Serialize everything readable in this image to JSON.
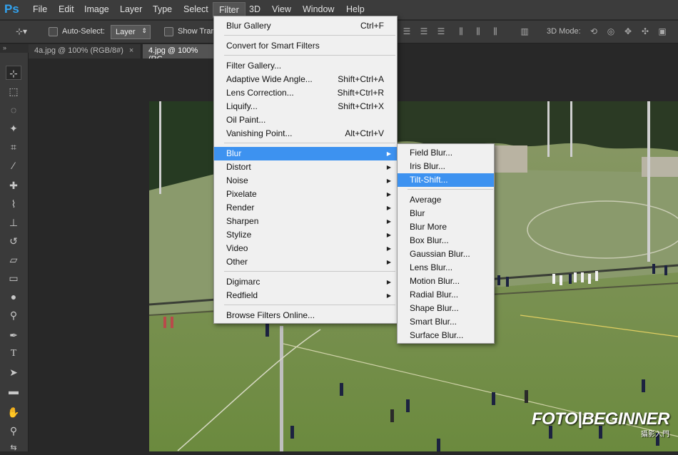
{
  "app": {
    "logo": "Ps"
  },
  "menubar": {
    "items": [
      "File",
      "Edit",
      "Image",
      "Layer",
      "Type",
      "Select",
      "Filter",
      "3D",
      "View",
      "Window",
      "Help"
    ]
  },
  "options": {
    "auto_select_label": "Auto-Select:",
    "layer_value": "Layer",
    "show_transform_label": "Show Trans",
    "mode_3d_label": "3D Mode:"
  },
  "tabs": [
    {
      "label": "4a.jpg @ 100% (RGB/8#)",
      "close": "×",
      "active": false
    },
    {
      "label": "4.jpg @ 100% (RG",
      "close": "",
      "active": true
    }
  ],
  "toolbar": {
    "collapse": "»"
  },
  "filter_menu": {
    "items": [
      {
        "label": "Blur Gallery",
        "shortcut": "Ctrl+F"
      },
      {
        "label": "Convert for Smart Filters",
        "shortcut": ""
      },
      {
        "label": "Filter Gallery...",
        "shortcut": ""
      },
      {
        "label": "Adaptive Wide Angle...",
        "shortcut": "Shift+Ctrl+A"
      },
      {
        "label": "Lens Correction...",
        "shortcut": "Shift+Ctrl+R"
      },
      {
        "label": "Liquify...",
        "shortcut": "Shift+Ctrl+X"
      },
      {
        "label": "Oil Paint...",
        "shortcut": ""
      },
      {
        "label": "Vanishing Point...",
        "shortcut": "Alt+Ctrl+V"
      },
      {
        "label": "Blur",
        "shortcut": ""
      },
      {
        "label": "Distort",
        "shortcut": ""
      },
      {
        "label": "Noise",
        "shortcut": ""
      },
      {
        "label": "Pixelate",
        "shortcut": ""
      },
      {
        "label": "Render",
        "shortcut": ""
      },
      {
        "label": "Sharpen",
        "shortcut": ""
      },
      {
        "label": "Stylize",
        "shortcut": ""
      },
      {
        "label": "Video",
        "shortcut": ""
      },
      {
        "label": "Other",
        "shortcut": ""
      },
      {
        "label": "Digimarc",
        "shortcut": ""
      },
      {
        "label": "Redfield",
        "shortcut": ""
      },
      {
        "label": "Browse Filters Online...",
        "shortcut": ""
      }
    ]
  },
  "blur_submenu": {
    "items": [
      "Field Blur...",
      "Iris Blur...",
      "Tilt-Shift...",
      "Average",
      "Blur",
      "Blur More",
      "Box Blur...",
      "Gaussian Blur...",
      "Lens Blur...",
      "Motion Blur...",
      "Radial Blur...",
      "Shape Blur...",
      "Smart Blur...",
      "Surface Blur..."
    ]
  },
  "watermark": {
    "main": "FOTO|BEGINNER",
    "sub": "攝影入門"
  },
  "colors": {
    "highlight": "#3d92f0",
    "chrome": "#3a3a3a",
    "menu_bg": "#f0f0f0"
  }
}
